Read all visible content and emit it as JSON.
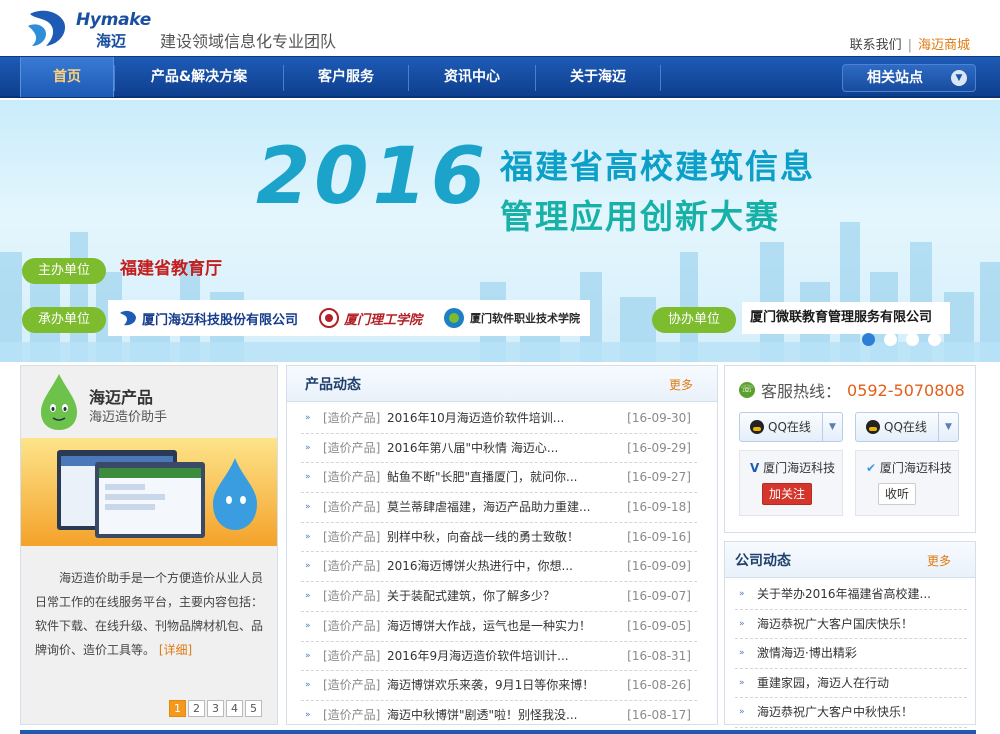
{
  "header": {
    "logo_en": "Hymake",
    "logo_cn": "海迈",
    "slogan": "建设领域信息化专业团队",
    "contact": "联系我们",
    "separator": "|",
    "mall": "海迈商城"
  },
  "nav": {
    "items": [
      {
        "label": "首页"
      },
      {
        "label": "产品&解决方案"
      },
      {
        "label": "客户服务"
      },
      {
        "label": "资讯中心"
      },
      {
        "label": "关于海迈"
      }
    ],
    "related": "相关站点"
  },
  "banner": {
    "year": "2016",
    "title_line1": "福建省高校建筑信息",
    "title_line2": "管理应用创新大赛",
    "host_label": "主办单位",
    "host_name": "福建省教育厅",
    "organizer_label": "承办单位",
    "organizers": [
      "厦门海迈科技股份有限公司",
      "厦门理工学院",
      "厦门软件职业技术学院"
    ],
    "co_label": "协办单位",
    "co_name": "厦门微联教育管理服务有限公司",
    "active_slide": 1,
    "slide_count": 4
  },
  "product": {
    "title": "海迈产品",
    "subtitle": "海迈造价助手",
    "description": "海迈造价助手是一个方便造价从业人员日常工作的在线服务平台，主要内容包括：软件下载、在线升级、刊物品牌材机包、品牌询价、造价工具等。",
    "more": "[详细]",
    "pages": [
      "1",
      "2",
      "3",
      "4",
      "5"
    ],
    "active_page": "1"
  },
  "news": {
    "title": "产品动态",
    "more": "更多",
    "items": [
      {
        "cat": "[造价产品]",
        "title": "2016年10月海迈造价软件培训...",
        "date": "[16-09-30]"
      },
      {
        "cat": "[造价产品]",
        "title": "2016年第八届\"中秋情 海迈心...",
        "date": "[16-09-29]"
      },
      {
        "cat": "[造价产品]",
        "title": "鲇鱼不断\"长肥\"直播厦门，就问你...",
        "date": "[16-09-27]"
      },
      {
        "cat": "[造价产品]",
        "title": "莫兰蒂肆虐福建，海迈产品助力重建...",
        "date": "[16-09-18]"
      },
      {
        "cat": "[造价产品]",
        "title": "别样中秋，向奋战一线的勇士致敬！",
        "date": "[16-09-16]"
      },
      {
        "cat": "[造价产品]",
        "title": "2016海迈博饼火热进行中，你想...",
        "date": "[16-09-09]"
      },
      {
        "cat": "[造价产品]",
        "title": "关于装配式建筑，你了解多少？",
        "date": "[16-09-07]"
      },
      {
        "cat": "[造价产品]",
        "title": "海迈博饼大作战，运气也是一种实力！",
        "date": "[16-09-05]"
      },
      {
        "cat": "[造价产品]",
        "title": "2016年9月海迈造价软件培训计...",
        "date": "[16-08-31]"
      },
      {
        "cat": "[造价产品]",
        "title": "海迈博饼欢乐来袭，9月1日等你来博！",
        "date": "[16-08-26]"
      },
      {
        "cat": "[造价产品]",
        "title": "海迈中秋博饼\"剧透\"啦！别怪我没...",
        "date": "[16-08-17]"
      }
    ]
  },
  "service": {
    "hotline_label": "客服热线：",
    "hotline_number": "0592-5070808",
    "qq1": "QQ在线",
    "qq2": "QQ在线",
    "weibo1_name": "厦门海迈科技",
    "weibo1_btn": "加关注",
    "weibo2_name": "厦门海迈科技",
    "weibo2_btn": "收听"
  },
  "company_news": {
    "title": "公司动态",
    "more": "更多",
    "items": [
      {
        "title": "关于举办2016年福建省高校建..."
      },
      {
        "title": "海迈恭祝广大客户国庆快乐！"
      },
      {
        "title": "激情海迈·博出精彩"
      },
      {
        "title": "重建家园，海迈人在行动"
      },
      {
        "title": "海迈恭祝广大客户中秋快乐！"
      }
    ]
  },
  "colors": {
    "nav_blue": "#1d5bb5",
    "accent_orange": "#e07a12",
    "pill_green": "#7dbb2f"
  }
}
